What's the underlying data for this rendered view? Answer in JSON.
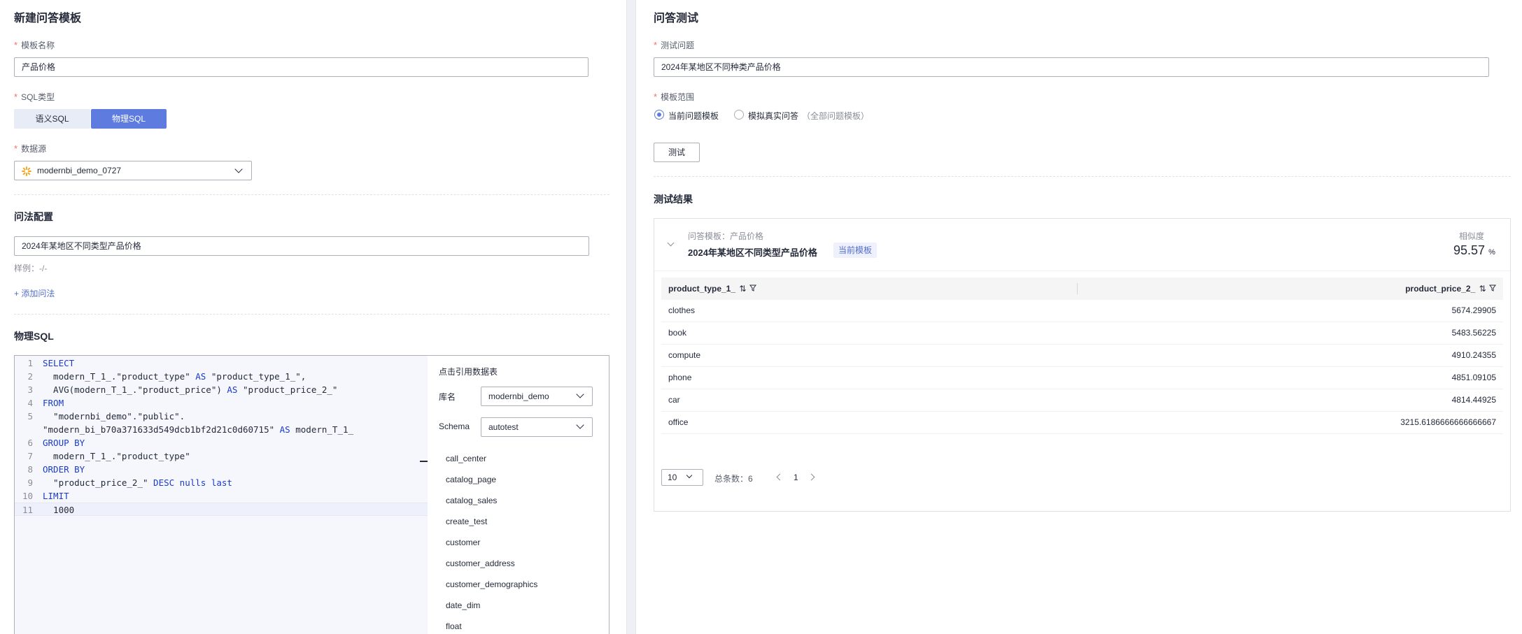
{
  "left": {
    "title": "新建问答模板",
    "template_name": {
      "label": "模板名称",
      "value": "产品价格"
    },
    "sql_type": {
      "label": "SQL类型",
      "options": [
        "语义SQL",
        "物理SQL"
      ],
      "selected": "物理SQL"
    },
    "datasource": {
      "label": "数据源",
      "value": "modernbi_demo_0727",
      "icon": "datasource-icon"
    },
    "question_config": {
      "title": "问法配置",
      "value": "2024年某地区不同类型产品价格",
      "example": "样例：-/-",
      "add_label": "+ 添加问法"
    },
    "physical_sql": {
      "title": "物理SQL",
      "lines": [
        {
          "n": "1",
          "parts": [
            {
              "t": "SELECT",
              "kw": true
            }
          ]
        },
        {
          "n": "2",
          "parts": [
            {
              "t": "  modern_T_1_.\"product_type\" "
            },
            {
              "t": "AS",
              "kw": true
            },
            {
              "t": " \"product_type_1_\","
            }
          ]
        },
        {
          "n": "3",
          "parts": [
            {
              "t": "  AVG(modern_T_1_.\"product_price\") "
            },
            {
              "t": "AS",
              "kw": true
            },
            {
              "t": " \"product_price_2_\""
            }
          ]
        },
        {
          "n": "4",
          "parts": [
            {
              "t": "FROM",
              "kw": true
            }
          ]
        },
        {
          "n": "5",
          "parts": [
            {
              "t": "  \"modernbi_demo\".\"public\"."
            }
          ]
        },
        {
          "n": "",
          "parts": [
            {
              "t": "\"modern_bi_b70a371633d549dcb1bf2d21c0d60715\" "
            },
            {
              "t": "AS",
              "kw": true
            },
            {
              "t": " modern_T_1_"
            }
          ]
        },
        {
          "n": "6",
          "parts": [
            {
              "t": "GROUP BY",
              "kw": true
            }
          ]
        },
        {
          "n": "7",
          "parts": [
            {
              "t": "  modern_T_1_.\"product_type\""
            }
          ]
        },
        {
          "n": "8",
          "parts": [
            {
              "t": "ORDER BY",
              "kw": true
            }
          ]
        },
        {
          "n": "9",
          "parts": [
            {
              "t": "  \"product_price_2_\" "
            },
            {
              "t": "DESC nulls last",
              "kw": true
            }
          ]
        },
        {
          "n": "10",
          "parts": [
            {
              "t": "LIMIT",
              "kw": true
            }
          ]
        },
        {
          "n": "11",
          "parts": [
            {
              "t": "  1000"
            }
          ]
        }
      ],
      "ref_title": "点击引用数据表",
      "db_label": "库名",
      "db_value": "modernbi_demo",
      "schema_label": "Schema",
      "schema_value": "autotest",
      "tables": [
        "call_center",
        "catalog_page",
        "catalog_sales",
        "create_test",
        "customer",
        "customer_address",
        "customer_demographics",
        "date_dim",
        "float"
      ]
    }
  },
  "right": {
    "title": "问答测试",
    "test_question": {
      "label": "测试问题",
      "value": "2024年某地区不同种类产品价格"
    },
    "scope": {
      "label": "模板范围",
      "options": [
        "当前问题模板",
        "模拟真实问答"
      ],
      "note": "（全部问题模板）",
      "selected": 0
    },
    "test_button": "测试",
    "result": {
      "title": "测试结果",
      "template_caption": "问答模板：产品价格",
      "question": "2024年某地区不同类型产品价格",
      "tag": "当前模板",
      "similarity_label": "相似度",
      "similarity_value": "95.57",
      "similarity_unit": "%",
      "columns": [
        "product_type_1_",
        "product_price_2_"
      ],
      "rows": [
        [
          "clothes",
          "5674.29905"
        ],
        [
          "book",
          "5483.56225"
        ],
        [
          "compute",
          "4910.24355"
        ],
        [
          "phone",
          "4851.09105"
        ],
        [
          "car",
          "4814.44925"
        ],
        [
          "office",
          "3215.6186666666666667"
        ]
      ],
      "page_size": "10",
      "total_label": "总条数：6",
      "page": "1"
    }
  },
  "colors": {
    "accent": "#5e7ce0",
    "required": "#f66f6a",
    "keyword": "#1a3bcc",
    "link": "#526ecc"
  }
}
